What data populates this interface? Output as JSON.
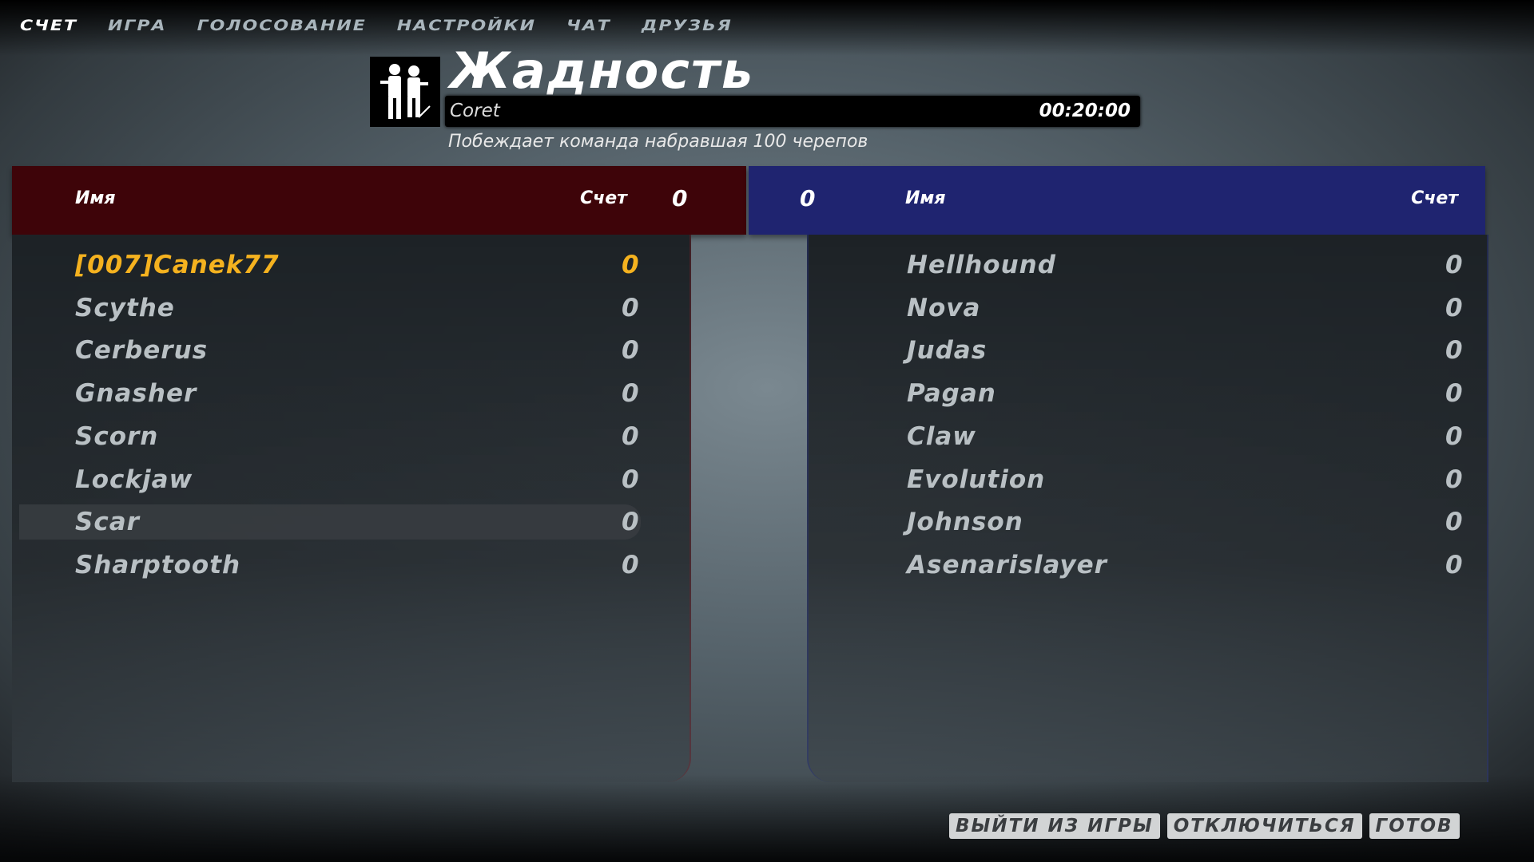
{
  "tabs": [
    {
      "label": "СЧЕТ",
      "active": true
    },
    {
      "label": "ИГРА"
    },
    {
      "label": "ГОЛОСОВАНИЕ"
    },
    {
      "label": "НАСТРОЙКИ"
    },
    {
      "label": "ЧАТ"
    },
    {
      "label": "ДРУЗЬЯ"
    }
  ],
  "match": {
    "mode_icon": "soldiers-icon",
    "title": "Жадность",
    "map": "Coret",
    "timer": "00:20:00",
    "objective": "Побеждает команда набравшая 100 черепов"
  },
  "red_team": {
    "color": "#3e0409",
    "name_header": "Имя",
    "score_header": "Счет",
    "team_score": "0",
    "players": [
      {
        "name": "[007]Canek77",
        "score": "0",
        "is_self": true
      },
      {
        "name": "Scythe",
        "score": "0"
      },
      {
        "name": "Cerberus",
        "score": "0"
      },
      {
        "name": "Gnasher",
        "score": "0"
      },
      {
        "name": "Scorn",
        "score": "0"
      },
      {
        "name": "Lockjaw",
        "score": "0"
      },
      {
        "name": "Scar",
        "score": "0",
        "highlighted": true
      },
      {
        "name": "Sharptooth",
        "score": "0"
      }
    ]
  },
  "blue_team": {
    "color": "#1f2470",
    "name_header": "Имя",
    "score_header": "Счет",
    "team_score": "0",
    "players": [
      {
        "name": "Hellhound",
        "score": "0"
      },
      {
        "name": "Nova",
        "score": "0"
      },
      {
        "name": "Judas",
        "score": "0"
      },
      {
        "name": "Pagan",
        "score": "0"
      },
      {
        "name": "Claw",
        "score": "0"
      },
      {
        "name": "Evolution",
        "score": "0"
      },
      {
        "name": "Johnson",
        "score": "0"
      },
      {
        "name": "Asenarislayer",
        "score": "0"
      }
    ]
  },
  "buttons": {
    "quit": "ВЫЙТИ ИЗ ИГРЫ",
    "disconnect": "ОТКЛЮЧИТЬСЯ",
    "ready": "ГОТОВ"
  },
  "self_color": "#f5b21f"
}
